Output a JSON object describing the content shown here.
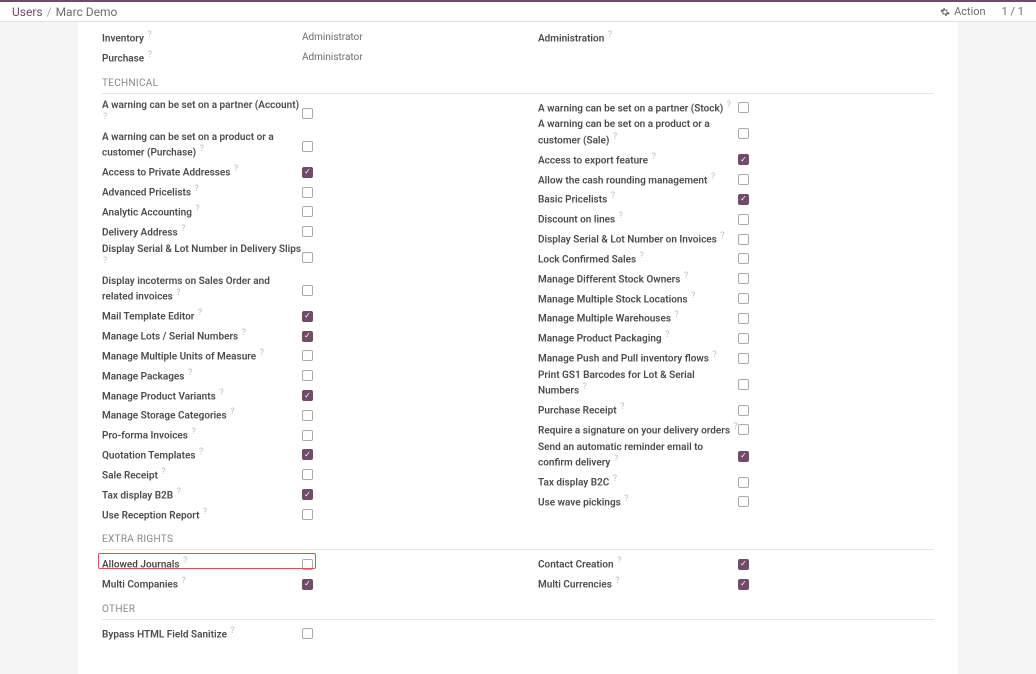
{
  "breadcrumb": {
    "root": "Users",
    "sep": "/",
    "current": "Marc Demo"
  },
  "topbar": {
    "action": "Action",
    "pager": "1 / 1"
  },
  "top_fields": {
    "left": [
      {
        "label": "Inventory",
        "value": "Administrator"
      },
      {
        "label": "Purchase",
        "value": "Administrator"
      }
    ],
    "right": [
      {
        "label": "Administration",
        "value": ""
      }
    ]
  },
  "sections": {
    "technical": {
      "title": "TECHNICAL",
      "left": [
        {
          "label": "A warning can be set on a partner (Account)",
          "checked": false
        },
        {
          "label": "A warning can be set on a product or a customer (Purchase)",
          "checked": false
        },
        {
          "label": "Access to Private Addresses",
          "checked": true
        },
        {
          "label": "Advanced Pricelists",
          "checked": false
        },
        {
          "label": "Analytic Accounting",
          "checked": false
        },
        {
          "label": "Delivery Address",
          "checked": false
        },
        {
          "label": "Display Serial & Lot Number in Delivery Slips",
          "checked": false
        },
        {
          "label": "Display incoterms on Sales Order and related invoices",
          "checked": false
        },
        {
          "label": "Mail Template Editor",
          "checked": true
        },
        {
          "label": "Manage Lots / Serial Numbers",
          "checked": true
        },
        {
          "label": "Manage Multiple Units of Measure",
          "checked": false
        },
        {
          "label": "Manage Packages",
          "checked": false
        },
        {
          "label": "Manage Product Variants",
          "checked": true
        },
        {
          "label": "Manage Storage Categories",
          "checked": false
        },
        {
          "label": "Pro-forma Invoices",
          "checked": false
        },
        {
          "label": "Quotation Templates",
          "checked": true
        },
        {
          "label": "Sale Receipt",
          "checked": false
        },
        {
          "label": "Tax display B2B",
          "checked": true
        },
        {
          "label": "Use Reception Report",
          "checked": false
        }
      ],
      "right": [
        {
          "label": "A warning can be set on a partner (Stock)",
          "checked": false
        },
        {
          "label": "A warning can be set on a product or a customer (Sale)",
          "checked": false
        },
        {
          "label": "Access to export feature",
          "checked": true
        },
        {
          "label": "Allow the cash rounding management",
          "checked": false
        },
        {
          "label": "Basic Pricelists",
          "checked": true
        },
        {
          "label": "Discount on lines",
          "checked": false
        },
        {
          "label": "Display Serial & Lot Number on Invoices",
          "checked": false
        },
        {
          "label": "Lock Confirmed Sales",
          "checked": false
        },
        {
          "label": "Manage Different Stock Owners",
          "checked": false
        },
        {
          "label": "Manage Multiple Stock Locations",
          "checked": false
        },
        {
          "label": "Manage Multiple Warehouses",
          "checked": false
        },
        {
          "label": "Manage Product Packaging",
          "checked": false
        },
        {
          "label": "Manage Push and Pull inventory flows",
          "checked": false
        },
        {
          "label": "Print GS1 Barcodes for Lot & Serial Numbers",
          "checked": false
        },
        {
          "label": "Purchase Receipt",
          "checked": false
        },
        {
          "label": "Require a signature on your delivery orders",
          "checked": false
        },
        {
          "label": "Send an automatic reminder email to confirm delivery",
          "checked": true
        },
        {
          "label": "Tax display B2C",
          "checked": false
        },
        {
          "label": "Use wave pickings",
          "checked": false
        }
      ]
    },
    "extra_rights": {
      "title": "EXTRA RIGHTS",
      "left": [
        {
          "label": "Allowed Journals",
          "checked": false,
          "highlight": true
        },
        {
          "label": "Multi Companies",
          "checked": true
        }
      ],
      "right": [
        {
          "label": "Contact Creation",
          "checked": true
        },
        {
          "label": "Multi Currencies",
          "checked": true
        }
      ]
    },
    "other": {
      "title": "OTHER",
      "left": [
        {
          "label": "Bypass HTML Field Sanitize",
          "checked": false
        }
      ],
      "right": []
    }
  }
}
